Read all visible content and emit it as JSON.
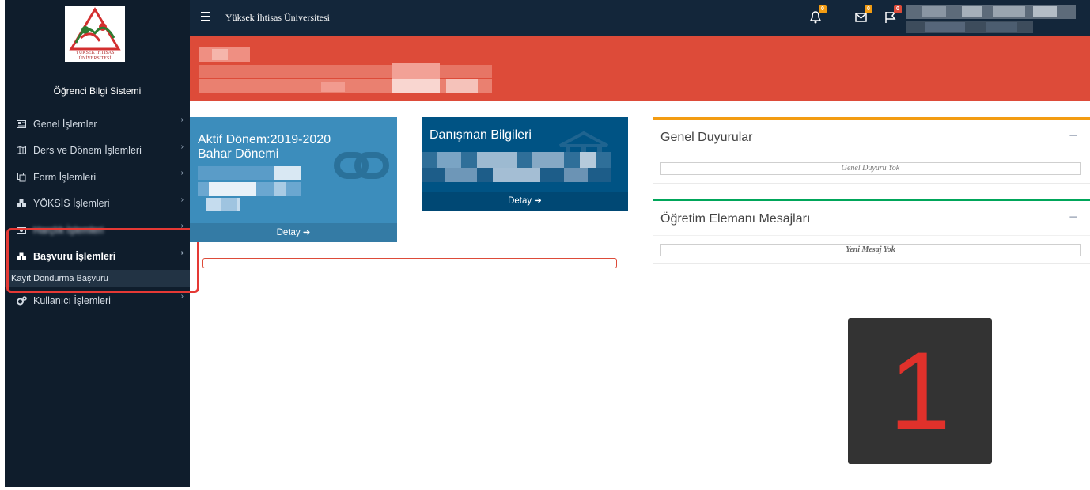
{
  "logo": {
    "line1": "YÜKSEK İHTİSAS",
    "line2": "ÜNİVERSİTESİ"
  },
  "sidebar": {
    "system_title": "Öğrenci Bilgi Sistemi",
    "items": [
      {
        "label": "Genel İşlemler",
        "icon": "newspaper-icon"
      },
      {
        "label": "Ders ve Dönem İşlemleri",
        "icon": "map-icon"
      },
      {
        "label": "Form İşlemleri",
        "icon": "copy-icon"
      },
      {
        "label": "YÖKSİS İşlemleri",
        "icon": "cubes-icon"
      },
      {
        "label": "Harçlık İşlemleri",
        "icon": "money-icon"
      },
      {
        "label": "Başvuru İşlemleri",
        "icon": "cubes-icon"
      },
      {
        "label": "Kullanıcı İşlemleri",
        "icon": "cogs-icon"
      }
    ],
    "submenu": {
      "label": "Kayıt Dondurma Başvuru"
    }
  },
  "topbar": {
    "brand": "Yüksek İhtisas Üniversitesi",
    "notifications": {
      "count": "0",
      "color": "#f39c12"
    },
    "messages": {
      "count": "0",
      "color": "#f39c12"
    },
    "flags": {
      "count": "0",
      "color": "#dd4b39"
    }
  },
  "widgets": {
    "active_term": {
      "title_line1": "Aktif Dönem:2019-2020",
      "title_line2": "Bahar Dönemi",
      "footer": "Detay ➜"
    },
    "advisor": {
      "title": "Danışman Bilgileri",
      "footer": "Detay ➜"
    }
  },
  "panels": {
    "announcements": {
      "title": "Genel Duyurular",
      "toggle": "−",
      "message": "Genel Duyuru Yok"
    },
    "messages": {
      "title": "Öğretim Elemanı Mesajları",
      "toggle": "−",
      "message": "Yeni Mesaj Yok"
    }
  },
  "step_marker": "1",
  "colors": {
    "sidebar": "#0f1d2c",
    "topbar": "#13263a",
    "banner": "#dd4b39",
    "widget_active_term": "#3c8dbc",
    "widget_advisor": "#005384",
    "panel_warning": "#f39c12",
    "panel_success": "#00a65a",
    "highlight": "#e53935"
  }
}
